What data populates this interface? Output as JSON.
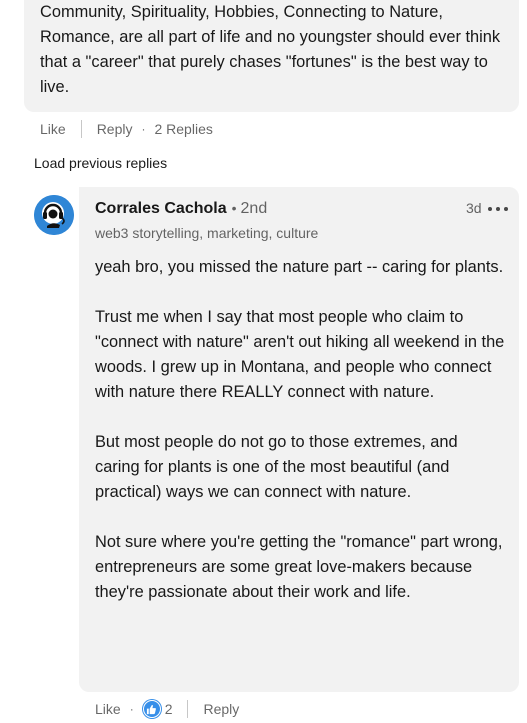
{
  "parent_comment": {
    "text": "Community, Spirituality, Hobbies, Connecting to Nature, Romance, are all part of life and no youngster should ever think that a \"career\" that purely chases \"fortunes\" is the best way to live.",
    "like_label": "Like",
    "reply_label": "Reply",
    "replies_count_label": "2 Replies"
  },
  "load_previous_label": "Load previous replies",
  "reply": {
    "author": "Corrales Cachola",
    "degree": "2nd",
    "headline": "web3 storytelling, marketing, culture",
    "time": "3d",
    "paragraphs": [
      "yeah bro, you missed the nature part -- caring for plants.",
      "Trust me when I say that most people who claim to \"connect with nature\" aren't out hiking all weekend in the woods. I grew up in Montana, and people who connect with nature there REALLY connect with nature.",
      "But most people do not go to those extremes, and caring for plants is one of the most beautiful (and practical) ways we can connect with nature.",
      "Not sure where you're getting the \"romance\" part wrong, entrepreneurs are some great love-makers because they're passionate about their work and life."
    ],
    "like_label": "Like",
    "reaction_count": "2",
    "reply_label": "Reply"
  },
  "colors": {
    "bubble_bg": "#f2f2f2",
    "like_blue": "#378fe9",
    "avatar_blue": "#2f86d6"
  }
}
